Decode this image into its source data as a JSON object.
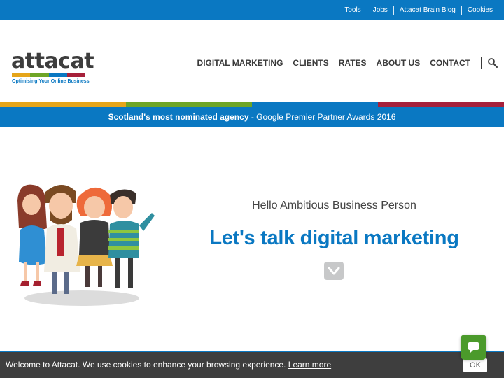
{
  "topbar": {
    "links": [
      "Tools",
      "Jobs",
      "Attacat Brain Blog",
      "Cookies"
    ]
  },
  "logo": {
    "wordmark": "attacat",
    "tagline": "Optimising Your Online Business",
    "bar_colors": [
      "#e5a51a",
      "#6ea526",
      "#0a78c2",
      "#a6203a"
    ]
  },
  "nav": {
    "items": [
      "DIGITAL MARKETING",
      "CLIENTS",
      "RATES",
      "ABOUT US",
      "CONTACT"
    ],
    "search_icon": "search-icon"
  },
  "strip": {
    "colors": [
      "#e5a51a",
      "#6ea526",
      "#0a78c2",
      "#a6203a"
    ]
  },
  "banner": {
    "highlight": "Scotland's most nominated agency",
    "rest": " - Google Premier Partner Awards 2016"
  },
  "hero": {
    "subtitle": "Hello Ambitious Business Person",
    "title": "Let's talk digital marketing",
    "scroll_icon": "chevron-down-icon"
  },
  "cookie": {
    "text": "Welcome to Attacat. We use cookies to enhance your browsing experience. ",
    "link": "Learn more",
    "ok": "OK"
  },
  "chat": {
    "icon": "chat-bubble-icon"
  },
  "colors": {
    "brand_blue": "#0a78c2",
    "text_dark": "#3a3a3a",
    "cookie_bg": "#3e3e3e",
    "chat_green": "#4b9a2b"
  }
}
